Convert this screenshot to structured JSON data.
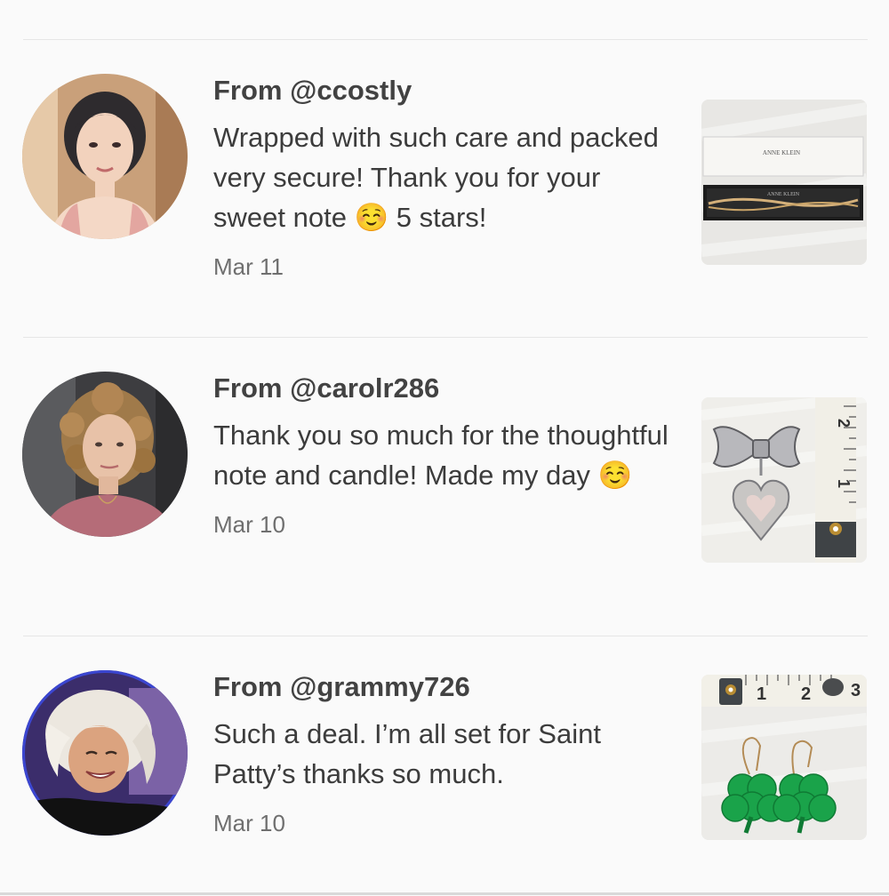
{
  "reviews": [
    {
      "from_prefix": "From ",
      "handle": "@ccostly",
      "comment": "Wrapped with such care and packed very secure! Thank you for your sweet note ☺️ 5 stars!",
      "date": "Mar 11",
      "avatar_icon": "cartoon-woman-avatar",
      "thumbnail_icon": "bracelet-box-photo"
    },
    {
      "from_prefix": "From ",
      "handle": "@carolr286",
      "comment": "Thank you so much for the thoughtful note and candle! Made my day ☺️",
      "date": "Mar 10",
      "avatar_icon": "curly-hair-woman-avatar",
      "thumbnail_icon": "bow-heart-locket-pin-photo"
    },
    {
      "from_prefix": "From ",
      "handle": "@grammy726",
      "comment": "Such a deal. I’m all set for Saint Patty’s thanks so much.",
      "date": "Mar 10",
      "avatar_icon": "blonde-woman-avatar",
      "thumbnail_icon": "shamrock-earrings-photo"
    }
  ],
  "ruler_marks": {
    "pin_photo": [
      "2",
      "1"
    ],
    "earrings_photo": [
      "1",
      "2",
      "3"
    ]
  },
  "colors": {
    "background": "#fafafa",
    "divider": "#e6e6e6",
    "text_primary": "#3c3c3c",
    "text_secondary": "#6f6f6f",
    "shamrock_green": "#1aa34a"
  }
}
